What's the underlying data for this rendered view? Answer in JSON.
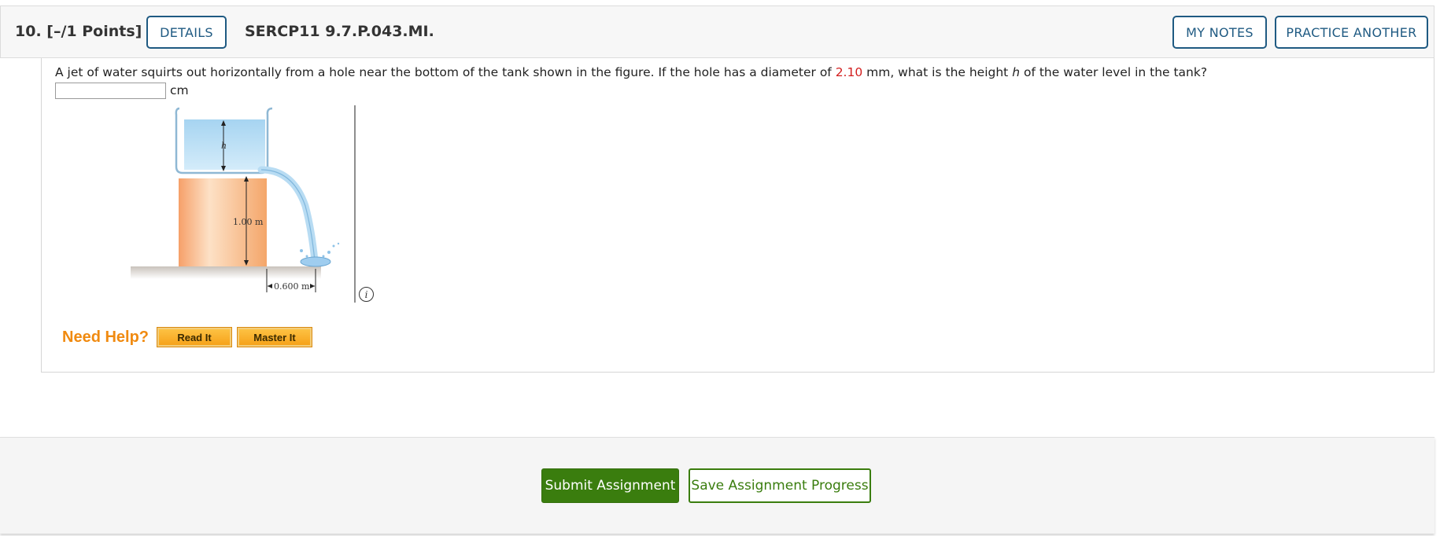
{
  "question": {
    "number_label": "10.  [–/1 Points]",
    "details_label": "DETAILS",
    "code": "SERCP11 9.7.P.043.MI.",
    "my_notes_label": "MY NOTES",
    "practice_label": "PRACTICE ANOTHER",
    "text_before": "A jet of water squirts out horizontally from a hole near the bottom of the tank shown in the figure. If the hole has a diameter of ",
    "diameter_value": "2.10",
    "text_middle": " mm, what is the height ",
    "variable": "h",
    "text_after": " of the water level in the tank?",
    "answer_value": "",
    "unit": "cm"
  },
  "figure": {
    "h_label": "h",
    "height_label": "1.00 m",
    "distance_label": "0.600 m",
    "info_icon_glyph": "i"
  },
  "help": {
    "title": "Need Help?",
    "read_it": "Read It",
    "master_it": "Master It"
  },
  "footer": {
    "submit_label": "Submit Assignment",
    "save_label": "Save Assignment Progress"
  },
  "colors": {
    "brand_blue": "#1f5a82",
    "submit_green": "#3a7d0e",
    "help_orange": "#f08a10",
    "value_red": "#d21e1e"
  }
}
